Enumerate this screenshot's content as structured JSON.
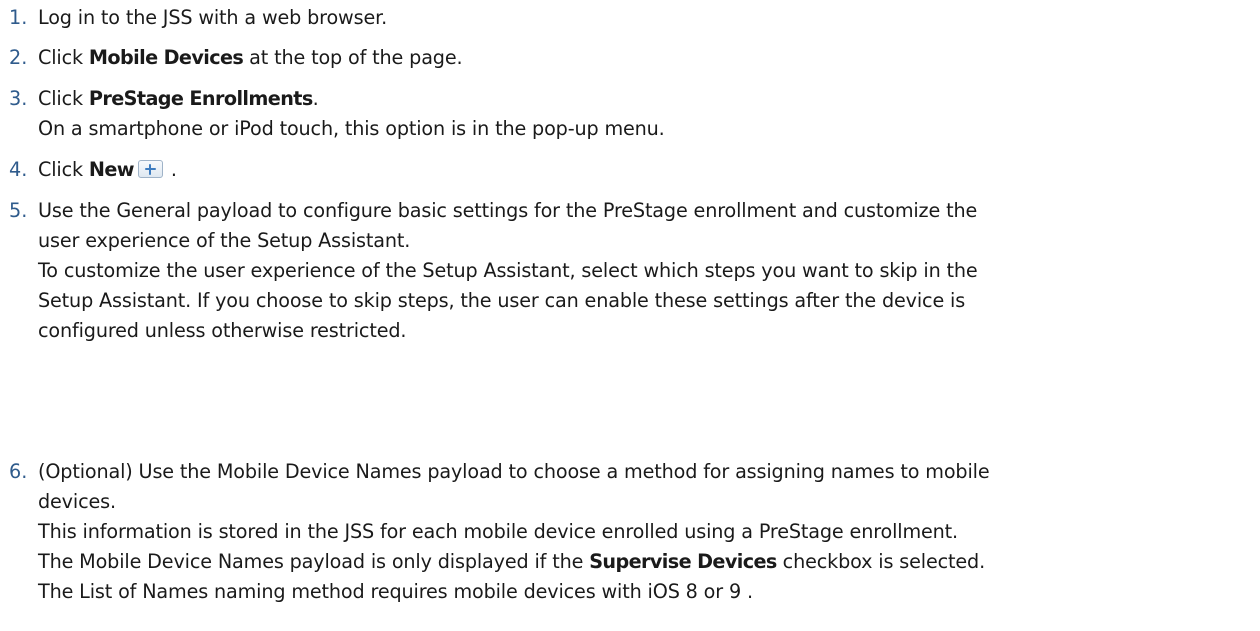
{
  "steps": [
    {
      "number": "1.",
      "text": "Log in to the JSS with a web browser."
    },
    {
      "number": "2.",
      "pre": "Click ",
      "bold": "Mobile Devices",
      "post": " at the top of the page."
    },
    {
      "number": "3.",
      "pre": "Click ",
      "bold": "PreStage Enrollments",
      "post": ".",
      "note": "On a smartphone or iPod touch, this option is in the pop-up menu."
    },
    {
      "number": "4.",
      "pre": "Click ",
      "bold": "New",
      "icon": "plus-icon",
      "post": " ."
    },
    {
      "number": "5.",
      "lines": [
        "Use the General payload to configure basic settings for the PreStage enrollment and customize the",
        "user experience of the Setup Assistant.",
        "To customize the user experience of the Setup Assistant, select which steps you want to skip in the",
        "Setup Assistant. If you choose to skip steps, the user can enable these settings after the device is",
        "configured unless otherwise restricted."
      ]
    },
    {
      "number": "6.",
      "lines": [
        "(Optional) Use the Mobile Device Names payload to choose a method for assigning names to mobile",
        "devices.",
        "This information is stored in the JSS for each mobile device enrolled using a PreStage enrollment."
      ],
      "line4_pre": "The Mobile Device Names payload is only displayed if the ",
      "line4_bold": "Supervise Devices",
      "line4_post": " checkbox is selected.",
      "line5": "The List of Names naming method requires mobile devices with iOS 8 or 9 ."
    }
  ],
  "colors": {
    "number": "#2f5b8c",
    "text": "#1a1a1a",
    "button_icon": "#3d7cc0"
  }
}
